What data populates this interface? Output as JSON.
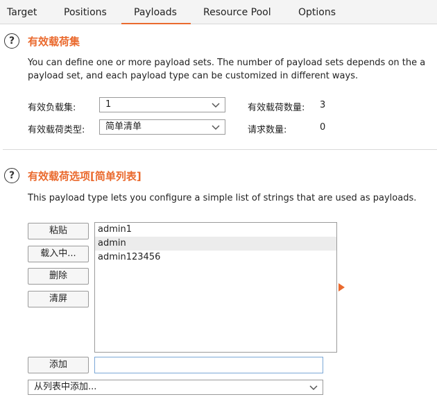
{
  "tabs": [
    "Target",
    "Positions",
    "Payloads",
    "Resource Pool",
    "Options"
  ],
  "payload_sets": {
    "title": "有效载荷集",
    "description_line1": "You can define one or more payload sets. The number of payload sets depends on the a",
    "description_line2": "payload set, and each payload type can be customized in different ways.",
    "set_label": "有效负载集:",
    "set_value": "1",
    "count_label": "有效载荷数量:",
    "count_value": "3",
    "type_label": "有效载荷类型:",
    "type_value": "简单清单",
    "request_label": "请求数量:",
    "request_value": "0"
  },
  "payload_options": {
    "title": "有效载荷选项[简单列表]",
    "description": "This payload type lets you configure a simple list of strings that are used as payloads.",
    "buttons": {
      "paste": "粘贴",
      "load": "载入中...",
      "remove": "删除",
      "clear": "清屏",
      "add": "添加"
    },
    "items": [
      "admin1",
      "admin",
      "admin123456"
    ],
    "selected_item": "admin",
    "add_input_value": "",
    "add_from_list": "从列表中添加..."
  },
  "colors": {
    "accent": "#ea6a2e"
  },
  "icons": [
    "help-icon",
    "chevron-down-icon",
    "expand-arrow-icon"
  ]
}
